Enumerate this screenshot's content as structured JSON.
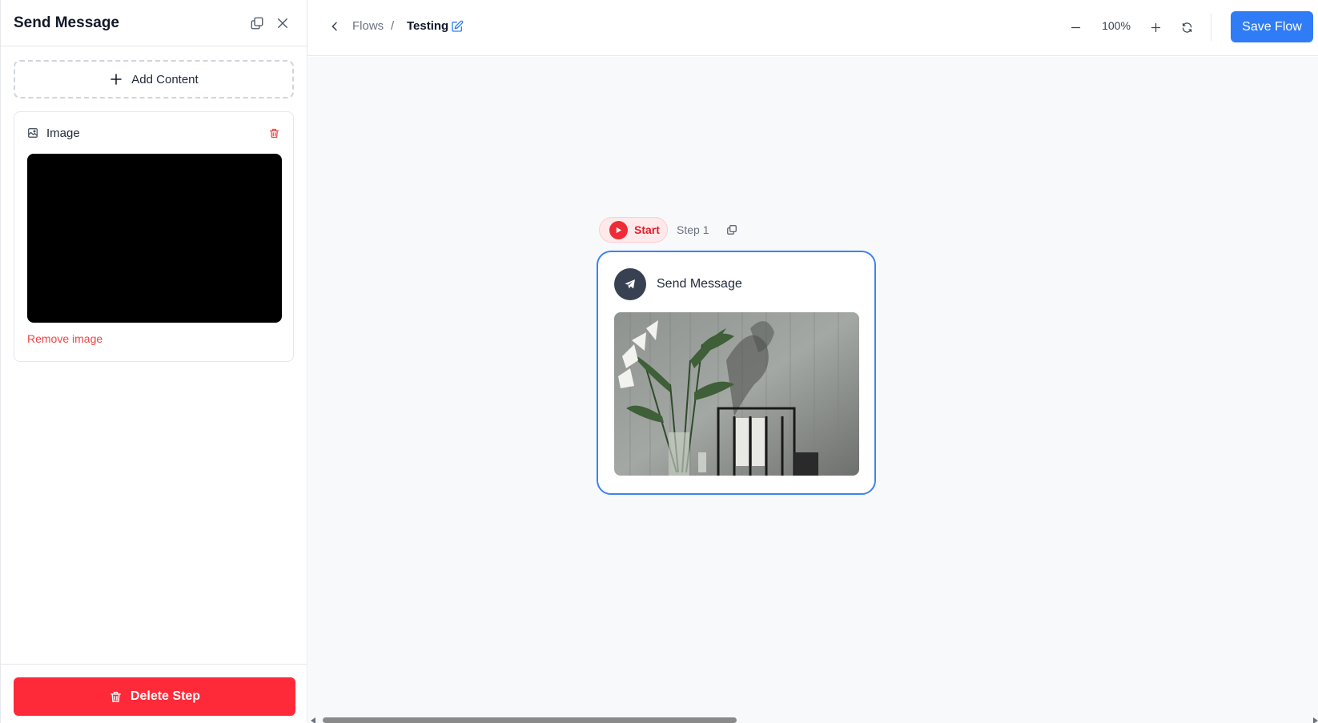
{
  "sidebar": {
    "title": "Send Message",
    "add_content_label": "Add Content",
    "image_card": {
      "label": "Image",
      "remove_label": "Remove image"
    },
    "delete_label": "Delete Step"
  },
  "topbar": {
    "breadcrumb_parent": "Flows",
    "breadcrumb_separator": "/",
    "breadcrumb_current": "Testing",
    "zoom_level": "100%",
    "save_label": "Save Flow"
  },
  "canvas": {
    "start_label": "Start",
    "step_label": "Step 1",
    "node": {
      "title": "Send Message"
    }
  },
  "colors": {
    "primary": "#2f7cf6",
    "danger": "#ff2a39",
    "node_border": "#3b82f6",
    "canvas_bg": "#f8f9fb"
  },
  "icons": {
    "duplicate": "copy-icon",
    "close": "close-icon",
    "add": "plus-icon",
    "image": "image-icon",
    "trash": "trash-icon",
    "back": "chevron-left-icon",
    "edit": "edit-icon",
    "zoom_out": "minus-icon",
    "zoom_in": "plus-icon",
    "reset": "refresh-icon",
    "play": "play-icon",
    "telegram": "send-icon"
  }
}
